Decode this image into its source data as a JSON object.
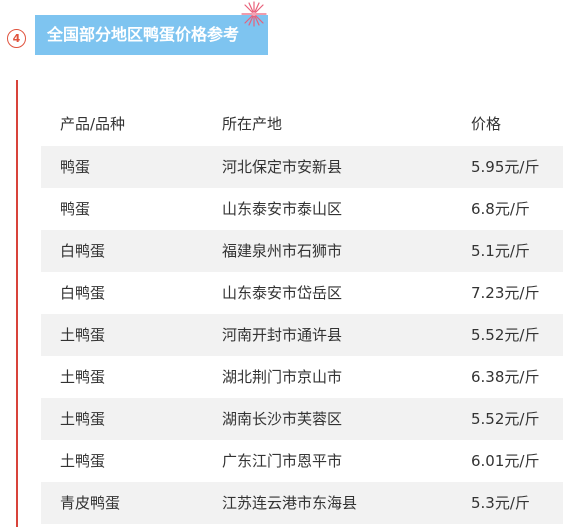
{
  "section": {
    "number": "4",
    "title": "全国部分地区鸭蛋价格参考"
  },
  "table": {
    "headers": [
      "产品/品种",
      "所在产地",
      "价格"
    ],
    "rows": [
      [
        "鸭蛋",
        "河北保定市安新县",
        "5.95元/斤"
      ],
      [
        "鸭蛋",
        "山东泰安市泰山区",
        "6.8元/斤"
      ],
      [
        "白鸭蛋",
        "福建泉州市石狮市",
        "5.1元/斤"
      ],
      [
        "白鸭蛋",
        "山东泰安市岱岳区",
        "7.23元/斤"
      ],
      [
        "土鸭蛋",
        "河南开封市通许县",
        "5.52元/斤"
      ],
      [
        "土鸭蛋",
        "湖北荆门市京山市",
        "6.38元/斤"
      ],
      [
        "土鸭蛋",
        "湖南长沙市芙蓉区",
        "5.52元/斤"
      ],
      [
        "土鸭蛋",
        "广东江门市恩平市",
        "6.01元/斤"
      ],
      [
        "青皮鸭蛋",
        "江苏连云港市东海县",
        "5.3元/斤"
      ]
    ]
  },
  "colors": {
    "title_bg": "#7ec4f0",
    "accent": "#d8433a",
    "shaded_row": "#f2f2f2",
    "text": "#333333"
  },
  "icons": [
    "firework-icon"
  ]
}
